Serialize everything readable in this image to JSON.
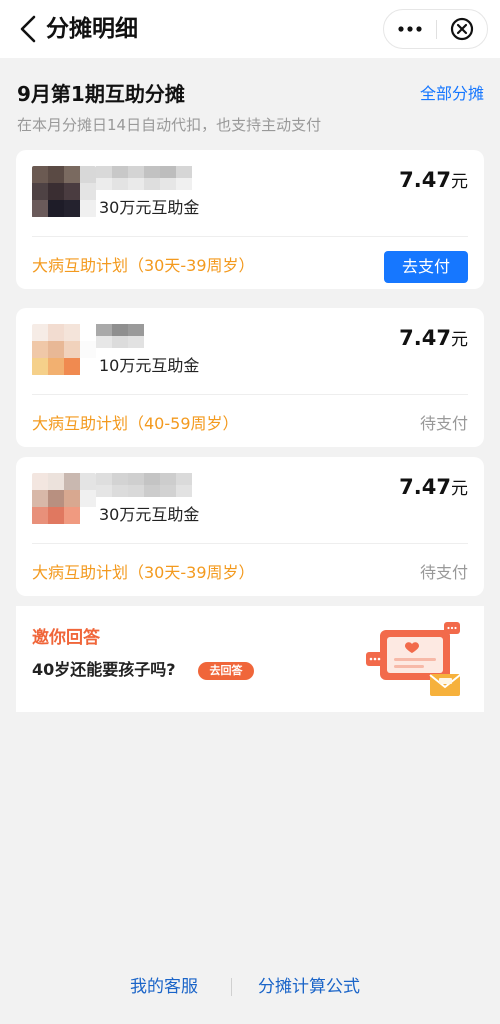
{
  "nav": {
    "title": "分摊明细",
    "back_icon": "chevron-left-icon",
    "more_icon": "more-dots-icon",
    "close_icon": "close-circle-icon"
  },
  "period": {
    "title": "9月第1期互助分摊",
    "subtitle": "在本月分摊日14日自动代扣，也支持主动支付",
    "all_link": "全部分摊"
  },
  "cards": [
    {
      "fund": "30万元互助金",
      "amount": "7.47",
      "unit": "元",
      "plan": "大病互助计划（30天-39周岁）",
      "action": "去支付",
      "avatar_colors": [
        "#6b5a52",
        "#5a4a44",
        "#7a6a60",
        "#d8d8d8",
        "#4e4244",
        "#3a2e32",
        "#4a3c40",
        "#e4e4e4",
        "#6a5a5a",
        "#1e1c28",
        "#24222e",
        "#f0f0f0"
      ],
      "name_colors": [
        "#d9d9d9",
        "#c8c8c8",
        "#d4d4d4",
        "#c2c2c2",
        "#bdbdbd",
        "#d6d6d6",
        "#ececec",
        "#e3e3e3",
        "#eaeaea",
        "#dedede",
        "#e6e6e6",
        "#f0f0f0"
      ]
    },
    {
      "fund": "10万元互助金",
      "amount": "7.47",
      "unit": "元",
      "plan": "大病互助计划（40-59周岁）",
      "status": "待支付",
      "avatar_colors": [
        "#f6ece6",
        "#f2dcd0",
        "#f4e4da",
        "#ffffff",
        "#f0c8a8",
        "#e8b896",
        "#f1d2bc",
        "#fbfbfb",
        "#f5d08a",
        "#f2b070",
        "#f08a50",
        "#ffffff"
      ],
      "name_colors": [
        "#a9a9a9",
        "#8f8f8f",
        "#9a9a9a",
        "#ffffff",
        "#ffffff",
        "#ffffff",
        "#e7e7e7",
        "#dcdcdc",
        "#e2e2e2",
        "#ffffff",
        "#ffffff",
        "#ffffff"
      ]
    },
    {
      "fund": "30万元互助金",
      "amount": "7.47",
      "unit": "元",
      "plan": "大病互助计划（30天-39周岁）",
      "status": "待支付",
      "avatar_colors": [
        "#f3e6e0",
        "#ece2dc",
        "#c9b8b0",
        "#e4e4e4",
        "#d8b8a8",
        "#b89080",
        "#d8a890",
        "#f0f0f0",
        "#e8907a",
        "#e07860",
        "#f09a80",
        "#ffffff"
      ],
      "name_colors": [
        "#dedede",
        "#d3d3d3",
        "#cfcfcf",
        "#c4c4c4",
        "#cdcdcd",
        "#dadada",
        "#e5e5e5",
        "#dcdcdc",
        "#d9d9d9",
        "#cccccc",
        "#d2d2d2",
        "#e2e2e2"
      ]
    }
  ],
  "qa": {
    "title": "邀你回答",
    "question": "40岁还能要孩子吗?",
    "badge": "去回答",
    "illustration_icon": "chat-envelope-illustration"
  },
  "footer": {
    "service": "我的客服",
    "formula": "分摊计算公式"
  },
  "colors": {
    "accent_blue": "#1677ff",
    "plan_orange": "#f39a1f",
    "qa_orange": "#f0663a",
    "page_bg": "#f2f2f2"
  }
}
